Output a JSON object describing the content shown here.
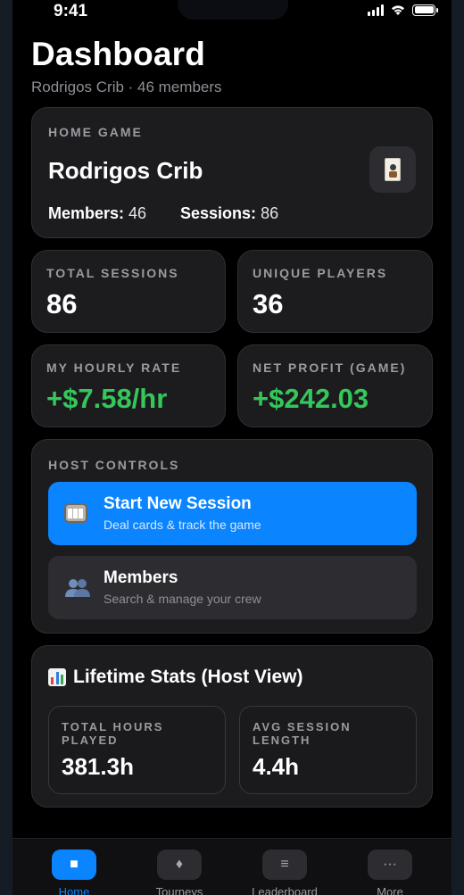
{
  "status_bar": {
    "time": "9:41"
  },
  "header": {
    "title": "Dashboard",
    "subtitle": "Rodrigos Crib · 46 members"
  },
  "home_game": {
    "label": "HOME GAME",
    "name": "Rodrigos Crib",
    "members_label": "Members:",
    "members_value": "46",
    "sessions_label": "Sessions:",
    "sessions_value": "86",
    "icon": "joker-card-icon"
  },
  "stats": {
    "total_sessions": {
      "label": "TOTAL SESSIONS",
      "value": "86"
    },
    "unique_players": {
      "label": "UNIQUE PLAYERS",
      "value": "36"
    },
    "hourly_rate": {
      "label": "MY HOURLY RATE",
      "value": "+$7.58/hr",
      "color": "#34c759"
    },
    "net_profit": {
      "label": "NET PROFIT (GAME)",
      "value": "+$242.03",
      "color": "#34c759"
    }
  },
  "host_controls": {
    "label": "HOST CONTROLS",
    "start_session": {
      "title": "Start New Session",
      "subtitle": "Deal cards & track the game",
      "icon": "slot-machine-icon"
    },
    "members": {
      "title": "Members",
      "subtitle": "Search & manage your crew",
      "icon": "people-icon"
    }
  },
  "lifetime": {
    "title": "Lifetime Stats (Host View)",
    "icon": "bar-chart-icon",
    "total_hours": {
      "label": "TOTAL HOURS PLAYED",
      "value": "381.3h"
    },
    "avg_session": {
      "label": "AVG SESSION LENGTH",
      "value": "4.4h"
    }
  },
  "tabbar": {
    "tabs": [
      {
        "label": "Home",
        "icon": "square-icon",
        "active": true
      },
      {
        "label": "Tourneys",
        "icon": "diamond-icon",
        "active": false
      },
      {
        "label": "Leaderboard",
        "icon": "list-icon",
        "active": false
      },
      {
        "label": "More",
        "icon": "ellipsis-icon",
        "active": false
      }
    ]
  },
  "colors": {
    "accent": "#0a84ff",
    "positive": "#34c759",
    "background": "#000000",
    "card": "#1c1c1f"
  }
}
